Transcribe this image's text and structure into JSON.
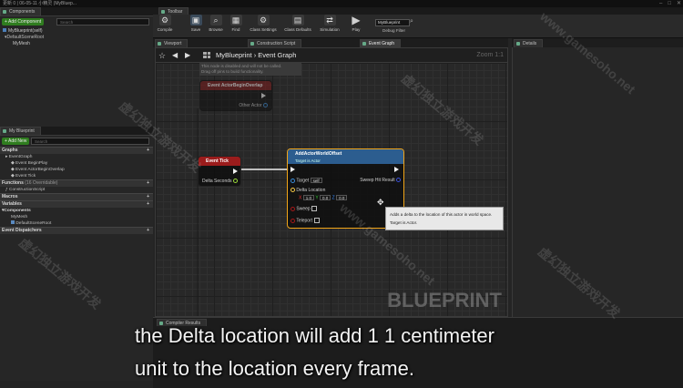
{
  "titlebar": {
    "text": "更新 0 | 06-05-11 小精灵 (MyBluep..."
  },
  "components_panel": {
    "tab": "Components",
    "add_button": "+ Add Component",
    "search_placeholder": "Search",
    "root": "MyBlueprint(self)",
    "scene_root": "DefaultSceneRoot",
    "mesh": "MyMesh"
  },
  "my_blueprint_panel": {
    "tab": "My Blueprint",
    "add_button": "+ Add New",
    "search_placeholder": "Search",
    "sections": {
      "graphs": "Graphs",
      "event_graph": "EventGraph",
      "events": [
        "Event BeginPlay",
        "Event ActorBeginOverlap",
        "Event Tick"
      ],
      "functions": "Functions",
      "functions_count": "(16 Overridable)",
      "construction_script": "ConstructionScript",
      "macros": "Macros",
      "variables": "Variables",
      "components": "Components",
      "component_items": [
        "MyMesh",
        "DefaultSceneRoot"
      ],
      "event_dispatchers": "Event Dispatchers"
    }
  },
  "toolbar": {
    "tab": "Toolbar",
    "buttons": [
      "Compile",
      "Save",
      "Browse",
      "Find",
      "Class Settings",
      "Class Defaults",
      "Simulation",
      "Play"
    ],
    "debug_select": "MyBlueprint",
    "debug_filter_label": "Debug Filter"
  },
  "editor_tabs": [
    "Viewport",
    "Construction Script",
    "Event Graph"
  ],
  "details_tab": "Details",
  "graph": {
    "breadcrumb_root": "MyBlueprint",
    "breadcrumb_sep": "›",
    "breadcrumb_current": "Event Graph",
    "zoom": "Zoom 1:1",
    "disabled_note_line1": "This node is disabled and will not be called.",
    "disabled_note_line2": "Drag off pins to build functionality.",
    "overlap_node": {
      "title": "Event ActorBeginOverlap",
      "pin": "Other Actor"
    },
    "tick_node": {
      "title": "Event Tick",
      "pin": "Delta Seconds"
    },
    "add_offset_node": {
      "title": "AddActorWorldOffset",
      "subtitle": "Target is Actor",
      "target_label": "Target",
      "target_value": "self",
      "delta_label": "Delta Location",
      "delta_x": "1.0",
      "delta_y": "0.0",
      "delta_z": "0.0",
      "sweep_label": "Sweep",
      "teleport_label": "Teleport",
      "sweep_hit_label": "Sweep Hit Result"
    },
    "tooltip_line1": "Adds a delta to the location of this actor in world space.",
    "tooltip_line2": "Target is Actor.",
    "watermark": "BLUEPRINT"
  },
  "compile_results_tab": "Compiler Results",
  "subtitle": {
    "line1": "the Delta location will add 1 1 centimeter",
    "line2": "unit to the location every frame."
  },
  "watermarks": [
    "www.gamesoho.net",
    "虚幻独立游戏开发"
  ],
  "colors": {
    "exec_pin": "#f0f0f0",
    "event_header": "#9b1c1c",
    "function_header": "#2c5d8f",
    "selected_outline": "#f2a518",
    "float_pin": "#9bdb3a",
    "vector_pin": "#f5c842",
    "bool_pin": "#a51818"
  }
}
